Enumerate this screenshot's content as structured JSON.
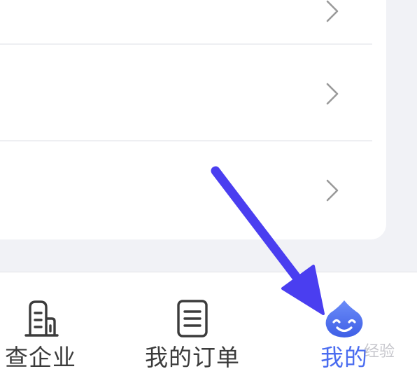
{
  "tabbar": {
    "tabs": [
      {
        "label": "查企业",
        "icon": "building-icon",
        "active": false
      },
      {
        "label": "我的订单",
        "icon": "order-list-icon",
        "active": false
      },
      {
        "label": "我的",
        "icon": "mascot-smile-icon",
        "active": true
      }
    ]
  },
  "watermark": {
    "text": "经验"
  },
  "colors": {
    "accent": "#4a6cf0",
    "annotation_arrow": "#4a3ef0",
    "tab_text": "#3b3b3b",
    "chevron": "#9a9a9a",
    "background": "#f1f2f6"
  }
}
